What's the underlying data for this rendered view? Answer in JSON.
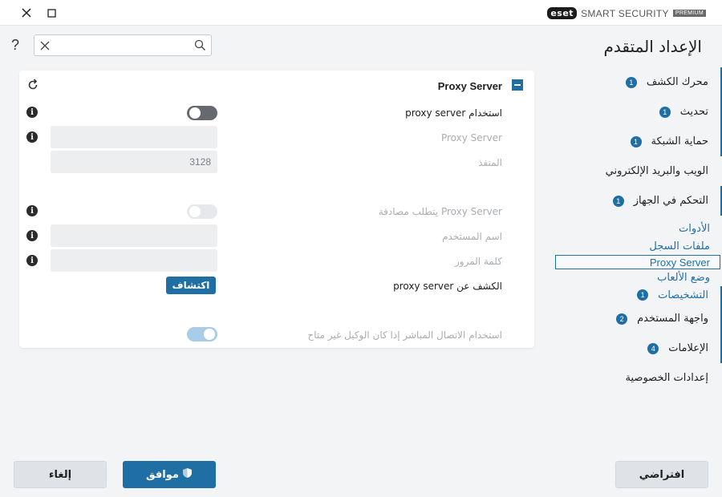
{
  "window": {
    "brand_logo": "eset",
    "brand_product": "SMART SECURITY",
    "brand_tier": "PREMIUM"
  },
  "help_label": "?",
  "search": {
    "value": "",
    "placeholder": ""
  },
  "page_title": "الإعداد المتقدم",
  "sidebar": {
    "items": [
      {
        "label": "محرك الكشف",
        "badge": "1"
      },
      {
        "label": "تحديث",
        "badge": "1"
      },
      {
        "label": "حماية الشبكة",
        "badge": "1"
      },
      {
        "label": "الويب والبريد الإلكتروني",
        "badge": ""
      },
      {
        "label": "التحكم في الجهاز",
        "badge": "1"
      }
    ],
    "tools": {
      "label": "الأدوات",
      "children": [
        "ملفات السجل",
        "Proxy Server",
        "وضع الألعاب"
      ]
    },
    "items_after": [
      {
        "label": "التشخيصات",
        "badge": "1"
      },
      {
        "label": "واجهة المستخدم",
        "badge": "2"
      },
      {
        "label": "الإعلامات",
        "badge": "4"
      },
      {
        "label": "إعدادات الخصوصية",
        "badge": ""
      }
    ]
  },
  "panel": {
    "title": "Proxy Server",
    "rows": {
      "use_proxy": "استخدام proxy server",
      "proxy_server": "Proxy Server",
      "port": "المنفذ",
      "port_value": "3128",
      "requires_auth": "Proxy Server يتطلب مصادقة",
      "username": "اسم المستخدم",
      "password": "كلمة المرور",
      "detect": "الكشف عن proxy server",
      "detect_button": "اكتشاف",
      "direct_fallback": "استخدام الاتصال المباشر إذا كان الوكيل غير متاح"
    },
    "toggles": {
      "use_proxy": false,
      "requires_auth": false,
      "direct_fallback": true
    }
  },
  "buttons": {
    "cancel": "إلغاء",
    "ok": "موافق",
    "default": "افتراضي"
  },
  "colors": {
    "accent": "#1f6fa5",
    "background": "#f3f4f6",
    "panel": "#ffffff"
  }
}
